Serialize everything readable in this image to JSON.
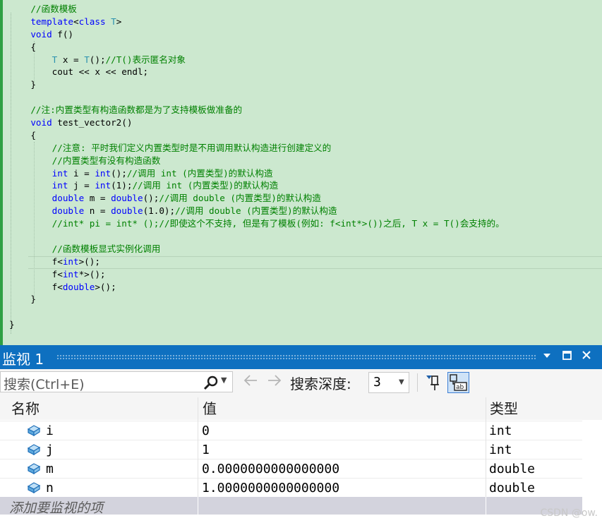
{
  "editor": {
    "lines": [
      [
        {
          "t": "    ",
          "c": "tx"
        },
        {
          "t": "//函数模板",
          "c": "cm"
        }
      ],
      [
        {
          "t": "    ",
          "c": "tx"
        },
        {
          "t": "template",
          "c": "kw"
        },
        {
          "t": "<",
          "c": "tx"
        },
        {
          "t": "class",
          "c": "kw"
        },
        {
          "t": " ",
          "c": "tx"
        },
        {
          "t": "T",
          "c": "ty"
        },
        {
          "t": ">",
          "c": "tx"
        }
      ],
      [
        {
          "t": "    ",
          "c": "tx"
        },
        {
          "t": "void",
          "c": "kw"
        },
        {
          "t": " f()",
          "c": "tx"
        }
      ],
      [
        {
          "t": "    {",
          "c": "tx"
        }
      ],
      [
        {
          "t": "        ",
          "c": "tx"
        },
        {
          "t": "T",
          "c": "ty"
        },
        {
          "t": " x = ",
          "c": "tx"
        },
        {
          "t": "T",
          "c": "ty"
        },
        {
          "t": "();",
          "c": "tx"
        },
        {
          "t": "//T()表示匿名对象",
          "c": "cm"
        }
      ],
      [
        {
          "t": "        cout << x << endl;",
          "c": "tx"
        }
      ],
      [
        {
          "t": "    }",
          "c": "tx"
        }
      ],
      [
        {
          "t": "",
          "c": "tx"
        }
      ],
      [
        {
          "t": "    ",
          "c": "tx"
        },
        {
          "t": "//注:内置类型有构造函数都是为了支持模板做准备的",
          "c": "cm"
        }
      ],
      [
        {
          "t": "    ",
          "c": "tx"
        },
        {
          "t": "void",
          "c": "kw"
        },
        {
          "t": " test_vector2()",
          "c": "tx"
        }
      ],
      [
        {
          "t": "    {",
          "c": "tx"
        }
      ],
      [
        {
          "t": "        ",
          "c": "tx"
        },
        {
          "t": "//注意: 平时我们定义内置类型时是不用调用默认构造进行创建定义的",
          "c": "cm"
        }
      ],
      [
        {
          "t": "        ",
          "c": "tx"
        },
        {
          "t": "//内置类型有没有构造函数",
          "c": "cm"
        }
      ],
      [
        {
          "t": "        ",
          "c": "tx"
        },
        {
          "t": "int",
          "c": "kw"
        },
        {
          "t": " i = ",
          "c": "tx"
        },
        {
          "t": "int",
          "c": "kw"
        },
        {
          "t": "();",
          "c": "tx"
        },
        {
          "t": "//调用 int (内置类型)的默认构造",
          "c": "cm"
        }
      ],
      [
        {
          "t": "        ",
          "c": "tx"
        },
        {
          "t": "int",
          "c": "kw"
        },
        {
          "t": " j = ",
          "c": "tx"
        },
        {
          "t": "int",
          "c": "kw"
        },
        {
          "t": "(1);",
          "c": "tx"
        },
        {
          "t": "//调用 int (内置类型)的默认构造",
          "c": "cm"
        }
      ],
      [
        {
          "t": "        ",
          "c": "tx"
        },
        {
          "t": "double",
          "c": "kw"
        },
        {
          "t": " m = ",
          "c": "tx"
        },
        {
          "t": "double",
          "c": "kw"
        },
        {
          "t": "();",
          "c": "tx"
        },
        {
          "t": "//调用 double (内置类型)的默认构造",
          "c": "cm"
        }
      ],
      [
        {
          "t": "        ",
          "c": "tx"
        },
        {
          "t": "double",
          "c": "kw"
        },
        {
          "t": " n = ",
          "c": "tx"
        },
        {
          "t": "double",
          "c": "kw"
        },
        {
          "t": "(1.0);",
          "c": "tx"
        },
        {
          "t": "//调用 double (内置类型)的默认构造",
          "c": "cm"
        }
      ],
      [
        {
          "t": "        ",
          "c": "tx"
        },
        {
          "t": "//int* pi = int* ();//即使这个不支持, 但是有了模板(例如: f<int*>())之后, T x = T()会支持的。",
          "c": "cm"
        }
      ],
      [
        {
          "t": "",
          "c": "tx"
        }
      ],
      [
        {
          "t": "        ",
          "c": "tx"
        },
        {
          "t": "//函数模板显式实例化调用",
          "c": "cm"
        }
      ],
      [
        {
          "t": "        f<",
          "c": "tx"
        },
        {
          "t": "int",
          "c": "kw"
        },
        {
          "t": ">();",
          "c": "tx"
        }
      ],
      [
        {
          "t": "        f<",
          "c": "tx"
        },
        {
          "t": "int",
          "c": "kw"
        },
        {
          "t": "*>();",
          "c": "tx"
        }
      ],
      [
        {
          "t": "        f<",
          "c": "tx"
        },
        {
          "t": "double",
          "c": "kw"
        },
        {
          "t": ">();",
          "c": "tx"
        }
      ],
      [
        {
          "t": "    }",
          "c": "tx"
        }
      ],
      [
        {
          "t": "",
          "c": "tx"
        }
      ],
      [
        {
          "t": "}",
          "c": "tx"
        }
      ]
    ]
  },
  "watch": {
    "title": "监视 1",
    "search_placeholder": "搜索(Ctrl+E)",
    "depth_label": "搜索深度:",
    "depth_value": "3",
    "columns": {
      "name": "名称",
      "value": "值",
      "type": "类型"
    },
    "rows": [
      {
        "name": "i",
        "value": "0",
        "type": "int"
      },
      {
        "name": "j",
        "value": "1",
        "type": "int"
      },
      {
        "name": "m",
        "value": "0.0000000000000000",
        "type": "double"
      },
      {
        "name": "n",
        "value": "1.0000000000000000",
        "type": "double"
      }
    ],
    "add_placeholder": "添加要监视的项",
    "icons": [
      "search-icon",
      "back-arrow-icon",
      "forward-arrow-icon",
      "pin-icon",
      "hex-display-icon",
      "variable-icon",
      "dropdown-icon",
      "maximize-icon",
      "close-icon"
    ],
    "accent_color": "#0e70c0"
  },
  "watermark": "CSDN @ow."
}
